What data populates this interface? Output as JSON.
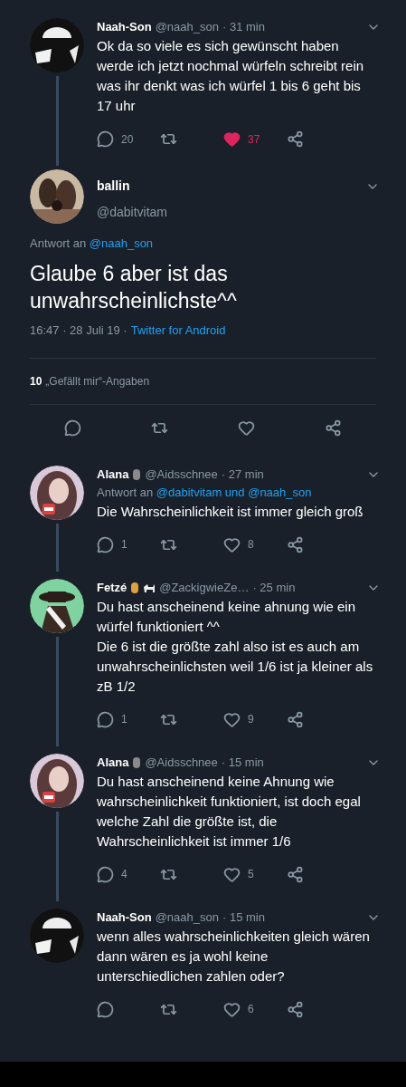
{
  "tweets": [
    {
      "kind": "compact",
      "name": "Naah-Son",
      "handle": "@naah_son",
      "time": "· 31 min",
      "text": "Ok da so viele es sich gewünscht haben werde ich jetzt nochmal würfeln schreibt rein was ihr denkt was ich würfel 1 bis 6 geht bis 17 uhr",
      "replies": "20",
      "likes": "37",
      "liked": true
    },
    {
      "kind": "focused",
      "name": "ballin",
      "handle": "@dabitvitam",
      "reply_to": [
        {
          "kind": "plain",
          "text": "Antwort an"
        },
        {
          "kind": "link",
          "text": "@naah_son"
        }
      ],
      "text": "Glaube 6 aber ist das unwahrscheinlichste^^",
      "meta": "16:47 · 28 Juli 19 ·",
      "source": "Twitter for Android",
      "like_count": "10",
      "like_label": "„Gefällt mir“-Angaben",
      "liked": false
    },
    {
      "kind": "compact",
      "name": "Alana",
      "badges": [
        {
          "kind": "emoji"
        }
      ],
      "handle": "@Aidsschnee",
      "time": "· 27 min",
      "reply_to": [
        {
          "kind": "plain",
          "text": "Antwort an"
        },
        {
          "kind": "link",
          "text": "@dabitvitam"
        },
        {
          "kind": "link",
          "text": "und"
        },
        {
          "kind": "link",
          "text": "@naah_son"
        }
      ],
      "text": "Die Wahrscheinlichkeit ist immer gleich groß",
      "replies": "1",
      "likes": "8",
      "liked": false
    },
    {
      "kind": "compact",
      "name": "Fetzé",
      "badges": [
        {
          "kind": "emoji"
        },
        {
          "kind": "animal"
        }
      ],
      "handle": "@ZackigwieZe…",
      "time": "· 25 min",
      "text": "Du hast anscheinend keine ahnung wie ein würfel funktioniert ^^\nDie 6 ist die größte zahl also ist es auch am unwahrscheinlichsten weil 1/6 ist ja kleiner als zB 1/2",
      "replies": "1",
      "likes": "9",
      "liked": false
    },
    {
      "kind": "compact",
      "name": "Alana",
      "badges": [
        {
          "kind": "emoji"
        }
      ],
      "handle": "@Aidsschnee",
      "time": "· 15 min",
      "text": "Du hast anscheinend keine Ahnung wie wahrscheinlichkeit funktioniert, ist doch egal welche Zahl die größte ist, die Wahrscheinlichkeit ist immer 1/6",
      "replies": "4",
      "likes": "5",
      "liked": false
    },
    {
      "kind": "compact",
      "name": "Naah-Son",
      "handle": "@naah_son",
      "time": "· 15 min",
      "text": "wenn alles wahrscheinlichkeiten gleich wären dann wären es ja wohl keine unterschiedlichen zahlen oder?",
      "likes": "6",
      "liked": false
    }
  ]
}
